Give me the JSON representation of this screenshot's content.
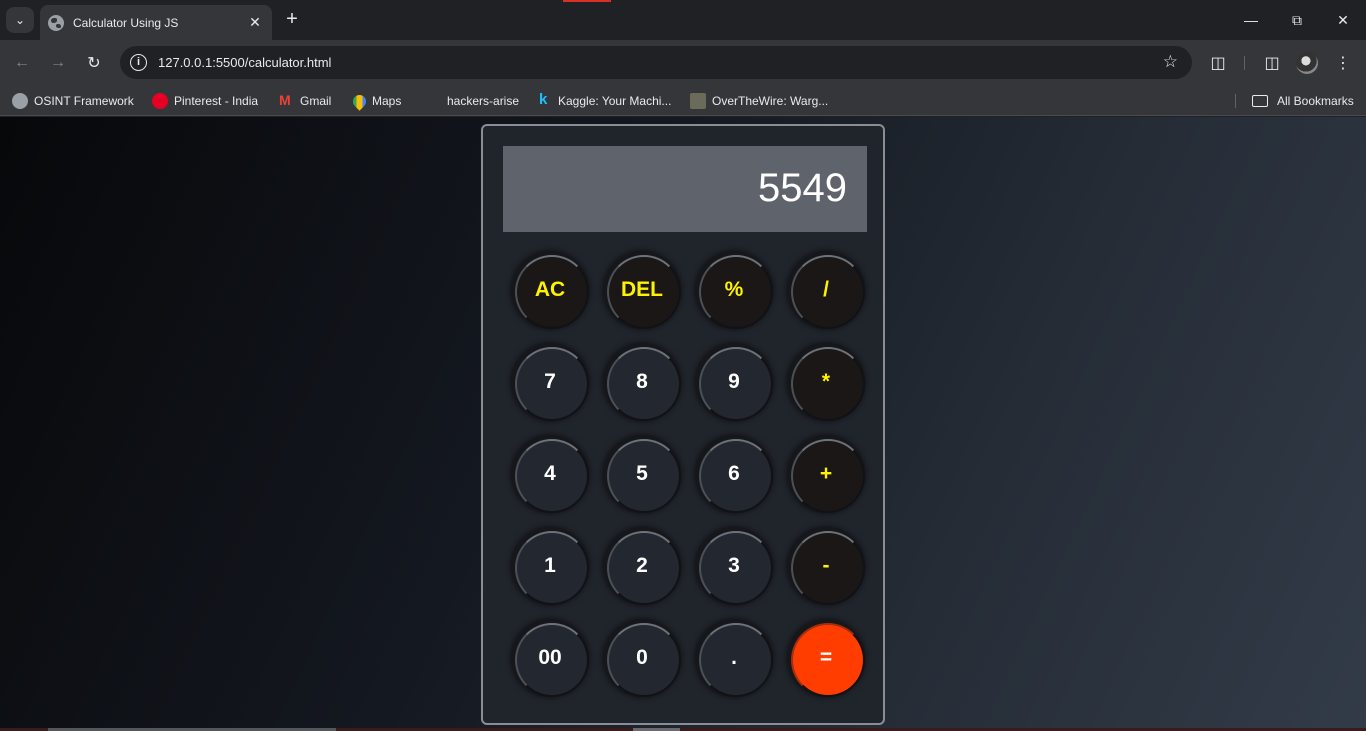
{
  "browser": {
    "tab_title": "Calculator Using JS",
    "url": "127.0.0.1:5500/calculator.html",
    "bookmarks": [
      {
        "label": "OSINT Framework",
        "icon": "globe-icon"
      },
      {
        "label": "Pinterest - India",
        "icon": "pinterest-icon"
      },
      {
        "label": "Gmail",
        "icon": "gmail-icon"
      },
      {
        "label": "Maps",
        "icon": "maps-icon"
      },
      {
        "label": "hackers-arise",
        "icon": "none"
      },
      {
        "label": "Kaggle: Your Machi...",
        "icon": "kaggle-icon"
      },
      {
        "label": "OverTheWire: Warg...",
        "icon": "overthewire-icon"
      }
    ],
    "all_bookmarks_label": "All Bookmarks"
  },
  "calculator": {
    "display_value": "5549",
    "keys": [
      [
        "AC",
        "DEL",
        "%",
        "/"
      ],
      [
        "7",
        "8",
        "9",
        "*"
      ],
      [
        "4",
        "5",
        "6",
        "+"
      ],
      [
        "1",
        "2",
        "3",
        "-"
      ],
      [
        "00",
        "0",
        ".",
        "="
      ]
    ],
    "colors": {
      "operator_text": "#fff200",
      "equals_bg": "#ff3d00",
      "display_bg": "#5f636b",
      "body_bg": "#20242b"
    }
  }
}
